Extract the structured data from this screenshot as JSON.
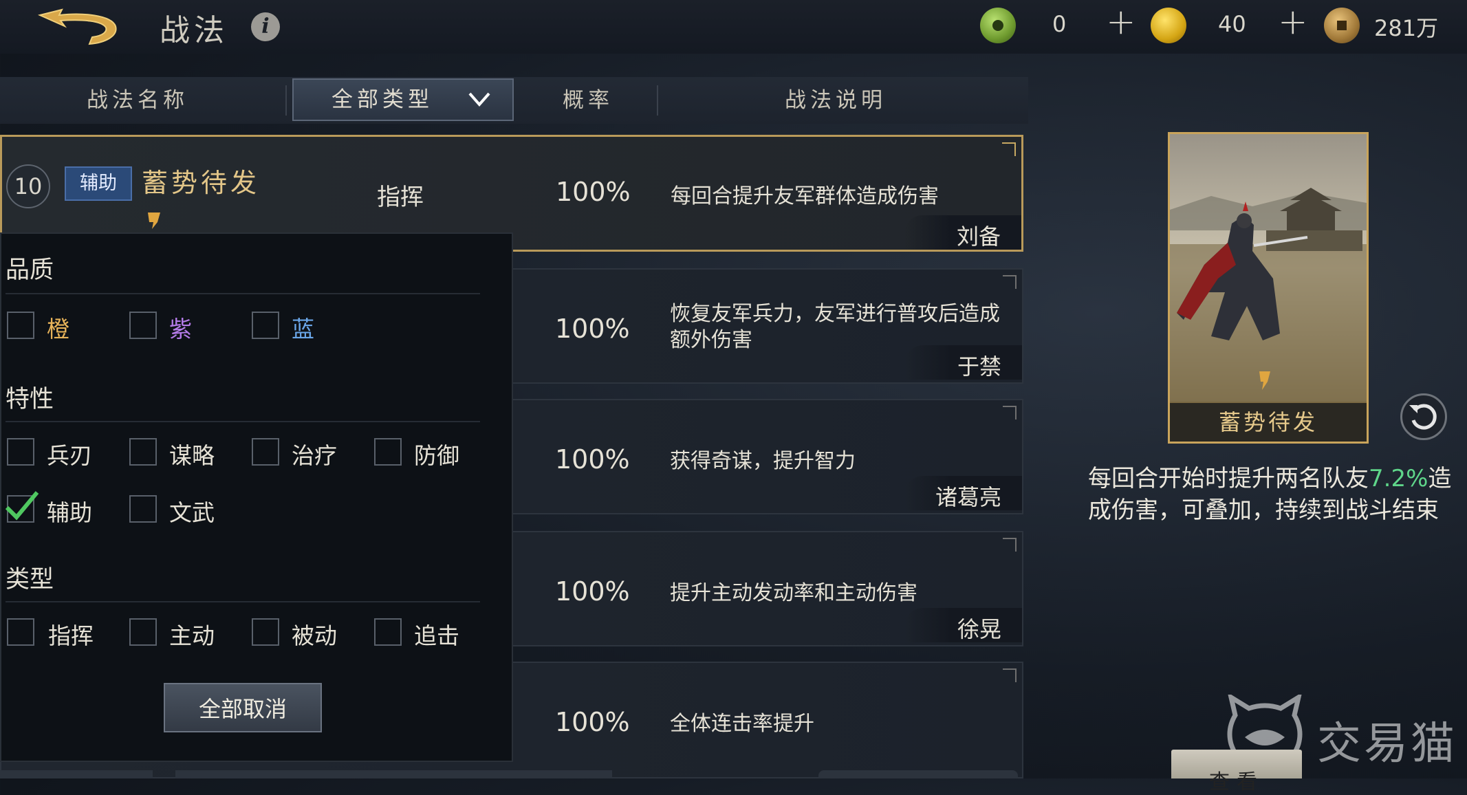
{
  "header": {
    "title": "战法",
    "info_icon": "i",
    "currencies": [
      {
        "icon": "jade-coin-icon",
        "value": "0"
      },
      {
        "icon": "gold-coin-icon",
        "value": "40"
      },
      {
        "icon": "copper-coin-icon",
        "value": "281万"
      }
    ],
    "plus": "+"
  },
  "columns": {
    "name": "战法名称",
    "type_filter": "全部类型",
    "rate": "概率",
    "desc": "战法说明"
  },
  "rows": [
    {
      "level": "10",
      "role": "辅助",
      "name": "蓄势待发",
      "kind": "指挥",
      "rate": "100%",
      "desc": "每回合提升友军群体造成伤害",
      "hero": "刘备"
    },
    {
      "rate": "100%",
      "desc": "恢复友军兵力，友军进行普攻后造成额外伤害",
      "hero": "于禁"
    },
    {
      "rate": "100%",
      "desc": "获得奇谋，提升智力",
      "hero": "诸葛亮"
    },
    {
      "rate": "100%",
      "desc": "提升主动发动率和主动伤害",
      "hero": "徐晃"
    },
    {
      "rate": "100%",
      "desc": "全体连击率提升",
      "hero": ""
    }
  ],
  "filter": {
    "quality_title": "品质",
    "quality": [
      {
        "label": "橙",
        "color": "#e8b45a",
        "checked": false
      },
      {
        "label": "紫",
        "color": "#b47be8",
        "checked": false
      },
      {
        "label": "蓝",
        "color": "#6aa6e8",
        "checked": false
      }
    ],
    "trait_title": "特性",
    "traits": [
      {
        "label": "兵刃",
        "checked": false
      },
      {
        "label": "谋略",
        "checked": false
      },
      {
        "label": "治疗",
        "checked": false
      },
      {
        "label": "防御",
        "checked": false
      },
      {
        "label": "辅助",
        "checked": true
      },
      {
        "label": "文武",
        "checked": false
      }
    ],
    "type_title": "类型",
    "types": [
      {
        "label": "指挥",
        "checked": false
      },
      {
        "label": "主动",
        "checked": false
      },
      {
        "label": "被动",
        "checked": false
      },
      {
        "label": "追击",
        "checked": false
      }
    ],
    "clear_label": "全部取消"
  },
  "detail": {
    "card_name": "蓄势待发",
    "desc_pre": "每回合开始时提升两名队友",
    "desc_pct": "7.2%",
    "desc_post": "造成伤害，可叠加，持续到战斗结束"
  },
  "watermark": "交易猫",
  "bottom_button": "查看",
  "colors": {
    "accent_gold": "#c9a45b",
    "green": "#5fd68a",
    "role_blue": "#2b4a78"
  }
}
